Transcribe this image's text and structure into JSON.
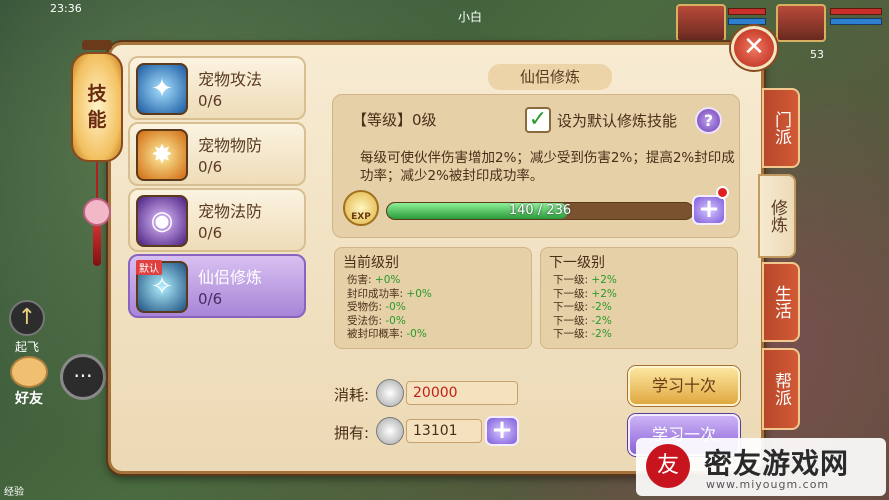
{
  "hud": {
    "clock": "23:36",
    "player_name": "小白",
    "pet_level": "53",
    "fly_label": "起飞",
    "friend_label": "好友",
    "chat_glyph": "···",
    "bottom_label": "经验"
  },
  "lantern": {
    "char1": "技",
    "char2": "能"
  },
  "close": {
    "glyph": "✕"
  },
  "skills": [
    {
      "name": "宠物攻法",
      "count": "0/6",
      "icon": "pet-attack-icon",
      "glyph": "✦"
    },
    {
      "name": "宠物物防",
      "count": "0/6",
      "icon": "pet-defense-icon",
      "glyph": "✸"
    },
    {
      "name": "宠物法防",
      "count": "0/6",
      "icon": "pet-magic-defense-icon",
      "glyph": "◉"
    },
    {
      "name": "仙侣修炼",
      "count": "0/6",
      "icon": "companion-training-icon",
      "glyph": "✧",
      "tag": "默认",
      "active": true
    }
  ],
  "detail": {
    "title": "仙侣修炼",
    "level": "【等级】0级",
    "default_check": "✓",
    "default_label": "设为默认修炼技能",
    "help": "?",
    "description": "每级可使伙伴伤害增加2%；减少受到伤害2%；提高2%封印成功率；减少2%被封印成功率。",
    "exp_icon_label": "EXP",
    "exp_text": "140 / 236",
    "exp_progress": 0.593,
    "plus": "+"
  },
  "current": {
    "title": "当前级别",
    "lines": [
      {
        "label": "伤害: ",
        "value": "+0%"
      },
      {
        "label": "封印成功率: ",
        "value": "+0%"
      },
      {
        "label": "受物伤: ",
        "value": "-0%"
      },
      {
        "label": "受法伤: ",
        "value": "-0%"
      },
      {
        "label": "被封印概率: ",
        "value": "-0%"
      }
    ]
  },
  "next": {
    "title": "下一级别",
    "lines": [
      {
        "label": "下一级: ",
        "value": "+2%"
      },
      {
        "label": "下一级: ",
        "value": "+2%"
      },
      {
        "label": "下一级: ",
        "value": "-2%"
      },
      {
        "label": "下一级: ",
        "value": "-2%"
      },
      {
        "label": "下一级: ",
        "value": "-2%"
      }
    ]
  },
  "resources": {
    "cost_label": "消耗:",
    "cost_value": "20000",
    "own_label": "拥有:",
    "own_value": "13101"
  },
  "buttons": {
    "learn_ten": "学习十次",
    "learn_once": "学习一次"
  },
  "tabs": [
    {
      "label": "门派"
    },
    {
      "label": "修炼",
      "active": true
    },
    {
      "label": "生活"
    },
    {
      "label": "帮派"
    }
  ],
  "watermark": {
    "logo_glyph": "友",
    "title": "密友游戏网",
    "url": "www.miyougm.com"
  },
  "colors": {
    "panel": "#f7ebd2",
    "accent_purple": "#8a62d6",
    "tab_red": "#c24e30",
    "exp_green": "#2a9a3a",
    "cost_red": "#c0201a"
  }
}
